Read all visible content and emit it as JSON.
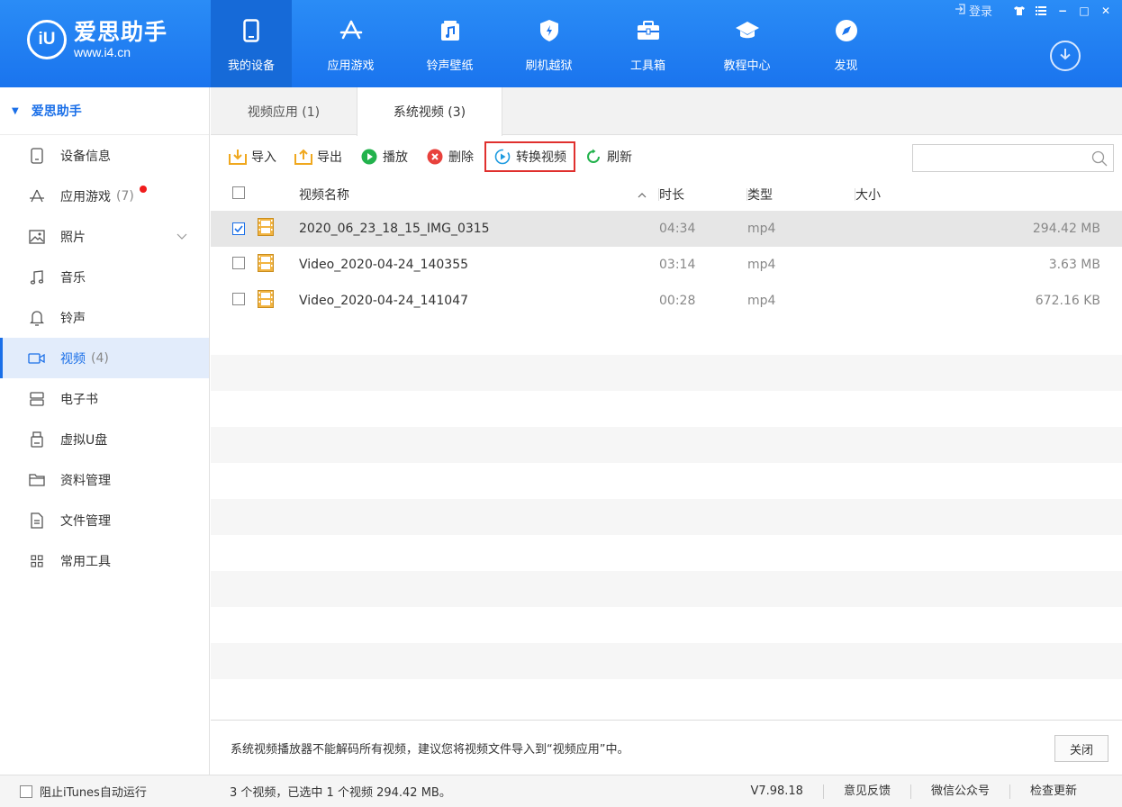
{
  "app": {
    "logo_mark": "iU",
    "name": "爱思助手",
    "url": "www.i4.cn"
  },
  "nav": [
    {
      "label": "我的设备",
      "icon": "phone-icon",
      "active": true
    },
    {
      "label": "应用游戏",
      "icon": "app-store-icon",
      "active": false
    },
    {
      "label": "铃声壁纸",
      "icon": "music-file-icon",
      "active": false
    },
    {
      "label": "刷机越狱",
      "icon": "shield-icon",
      "active": false
    },
    {
      "label": "工具箱",
      "icon": "toolbox-icon",
      "active": false
    },
    {
      "label": "教程中心",
      "icon": "graduation-cap-icon",
      "active": false
    },
    {
      "label": "发现",
      "icon": "compass-icon",
      "active": false
    }
  ],
  "window": {
    "login_label": "登录",
    "skin_icon": "shirt-icon",
    "menu_icon": "menu-icon",
    "minimize": "−",
    "maximize": "□",
    "close": "✕"
  },
  "sidebar": {
    "device_name": "爱思助手",
    "items": [
      {
        "label": "设备信息",
        "icon": "device-info-icon",
        "count": ""
      },
      {
        "label": "应用游戏",
        "icon": "app-icon",
        "count": "(7)",
        "badge": true
      },
      {
        "label": "照片",
        "icon": "photo-icon",
        "count": "",
        "expandable": true
      },
      {
        "label": "音乐",
        "icon": "music-note-icon",
        "count": ""
      },
      {
        "label": "铃声",
        "icon": "bell-icon",
        "count": ""
      },
      {
        "label": "视频",
        "icon": "video-icon",
        "count": "(4)",
        "active": true
      },
      {
        "label": "电子书",
        "icon": "book-icon",
        "count": ""
      },
      {
        "label": "虚拟U盘",
        "icon": "usb-drive-icon",
        "count": ""
      },
      {
        "label": "资料管理",
        "icon": "folder-icon",
        "count": ""
      },
      {
        "label": "文件管理",
        "icon": "file-icon",
        "count": ""
      },
      {
        "label": "常用工具",
        "icon": "grid-icon",
        "count": ""
      }
    ]
  },
  "tabs": [
    {
      "label": "视频应用 (1)",
      "active": false
    },
    {
      "label": "系统视频 (3)",
      "active": true
    }
  ],
  "toolbar": {
    "import": "导入",
    "export": "导出",
    "play": "播放",
    "delete": "删除",
    "convert": "转换视频",
    "refresh": "刷新",
    "search_placeholder": ""
  },
  "table": {
    "headers": {
      "name": "视频名称",
      "duration": "时长",
      "type": "类型",
      "size": "大小"
    },
    "rows": [
      {
        "name": "2020_06_23_18_15_IMG_0315",
        "duration": "04:34",
        "type": "mp4",
        "size": "294.42 MB",
        "checked": true
      },
      {
        "name": "Video_2020-04-24_140355",
        "duration": "03:14",
        "type": "mp4",
        "size": "3.63 MB",
        "checked": false
      },
      {
        "name": "Video_2020-04-24_141047",
        "duration": "00:28",
        "type": "mp4",
        "size": "672.16 KB",
        "checked": false
      }
    ]
  },
  "notice": {
    "text": "系统视频播放器不能解码所有视频，建议您将视频文件导入到“视频应用”中。",
    "close": "关闭"
  },
  "status": {
    "itunes_label": "阻止iTunes自动运行",
    "summary": "3 个视频，已选中 1 个视频 294.42 MB。",
    "version": "V7.98.18",
    "feedback": "意见反馈",
    "wechat": "微信公众号",
    "update": "检查更新"
  },
  "colors": {
    "brand_blue": "#1a74ee",
    "highlight_red": "#e0302e",
    "badge_red": "#f01c1c"
  }
}
